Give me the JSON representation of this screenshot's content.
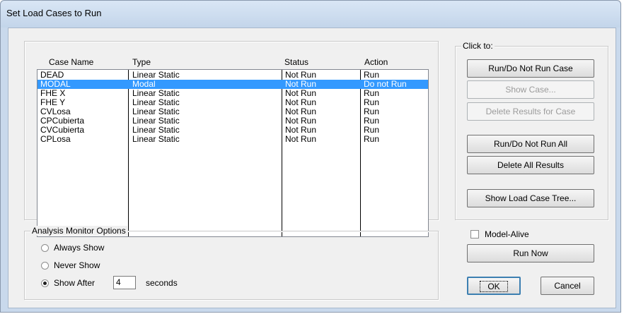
{
  "window": {
    "title": "Set Load Cases to Run"
  },
  "table": {
    "headers": {
      "case_name": "Case Name",
      "type": "Type",
      "status": "Status",
      "action": "Action"
    },
    "rows": [
      {
        "case_name": "DEAD",
        "type": "Linear Static",
        "status": "Not Run",
        "action": "Run"
      },
      {
        "case_name": "MODAL",
        "type": "Modal",
        "status": "Not Run",
        "action": "Do not Run"
      },
      {
        "case_name": "FHE X",
        "type": "Linear Static",
        "status": "Not Run",
        "action": "Run"
      },
      {
        "case_name": "FHE Y",
        "type": "Linear Static",
        "status": "Not Run",
        "action": "Run"
      },
      {
        "case_name": "CVLosa",
        "type": "Linear Static",
        "status": "Not Run",
        "action": "Run"
      },
      {
        "case_name": "CPCubierta",
        "type": "Linear Static",
        "status": "Not Run",
        "action": "Run"
      },
      {
        "case_name": "CVCubierta",
        "type": "Linear Static",
        "status": "Not Run",
        "action": "Run"
      },
      {
        "case_name": "CPLosa",
        "type": "Linear Static",
        "status": "Not Run",
        "action": "Run"
      }
    ],
    "selected_row": 1
  },
  "click_to": {
    "legend": "Click to:",
    "run_case": "Run/Do Not Run Case",
    "show_case": "Show Case...",
    "delete_results_case": "Delete Results for Case",
    "run_all": "Run/Do Not Run All",
    "delete_all": "Delete All Results",
    "show_tree": "Show Load Case Tree..."
  },
  "monitor": {
    "legend": "Analysis Monitor Options",
    "always_show": "Always Show",
    "never_show": "Never Show",
    "show_after": "Show After",
    "seconds_value": "4",
    "seconds_label": "seconds",
    "selected": "show_after"
  },
  "bottom": {
    "model_alive": "Model-Alive",
    "run_now": "Run Now",
    "ok": "OK",
    "cancel": "Cancel"
  }
}
